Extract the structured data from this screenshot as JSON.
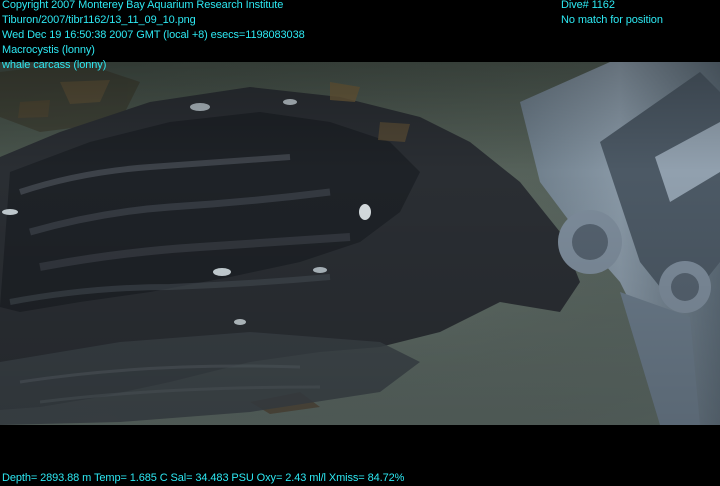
{
  "overlay": {
    "top_left": [
      "Copyright 2007 Monterey Bay Aquarium Research Institute",
      "Tiburon/2007/tibr1162/13_11_09_10.png",
      "Wed Dec 19 16:50:38 2007 GMT (local +8)  esecs=1198083038",
      "Macrocystis (lonny)",
      "whale carcass (lonny)"
    ],
    "top_right": [
      "Dive# 1162",
      "No match for position"
    ],
    "bottom": "Depth= 2893.88 m  Temp= 1.685 C  Sal= 34.483 PSU  Oxy= 2.43 ml/l  Xmiss= 84.72%"
  },
  "colors": {
    "overlay_text": "#2de8f2",
    "background": "#000000",
    "sediment": "#4f5a52",
    "carcass": "#2a2e33"
  }
}
